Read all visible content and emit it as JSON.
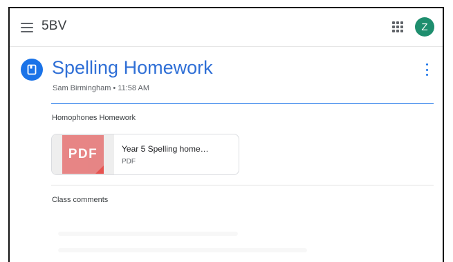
{
  "topbar": {
    "class_name": "5BV",
    "avatar_letter": "Z"
  },
  "post": {
    "title": "Spelling Homework",
    "author": "Sam Birmingham",
    "time": "11:58 AM",
    "meta": "Sam Birmingham • 11:58 AM",
    "description": "Homophones Homework"
  },
  "attachment": {
    "badge": "PDF",
    "title": "Year 5 Spelling home…",
    "type": "PDF"
  },
  "comments": {
    "heading": "Class comments"
  },
  "icons": {
    "menu": "hamburger-menu-icon",
    "apps": "google-apps-grid-icon",
    "post": "assignment-book-icon",
    "more": "more-vertical-icon",
    "file": "pdf-file-icon"
  },
  "colors": {
    "accent_blue": "#1a73e8",
    "title_blue": "#2f6fd6",
    "avatar_green": "#1e8e6e",
    "pdf_red": "#e57373",
    "divider": "#e0e0e0"
  }
}
